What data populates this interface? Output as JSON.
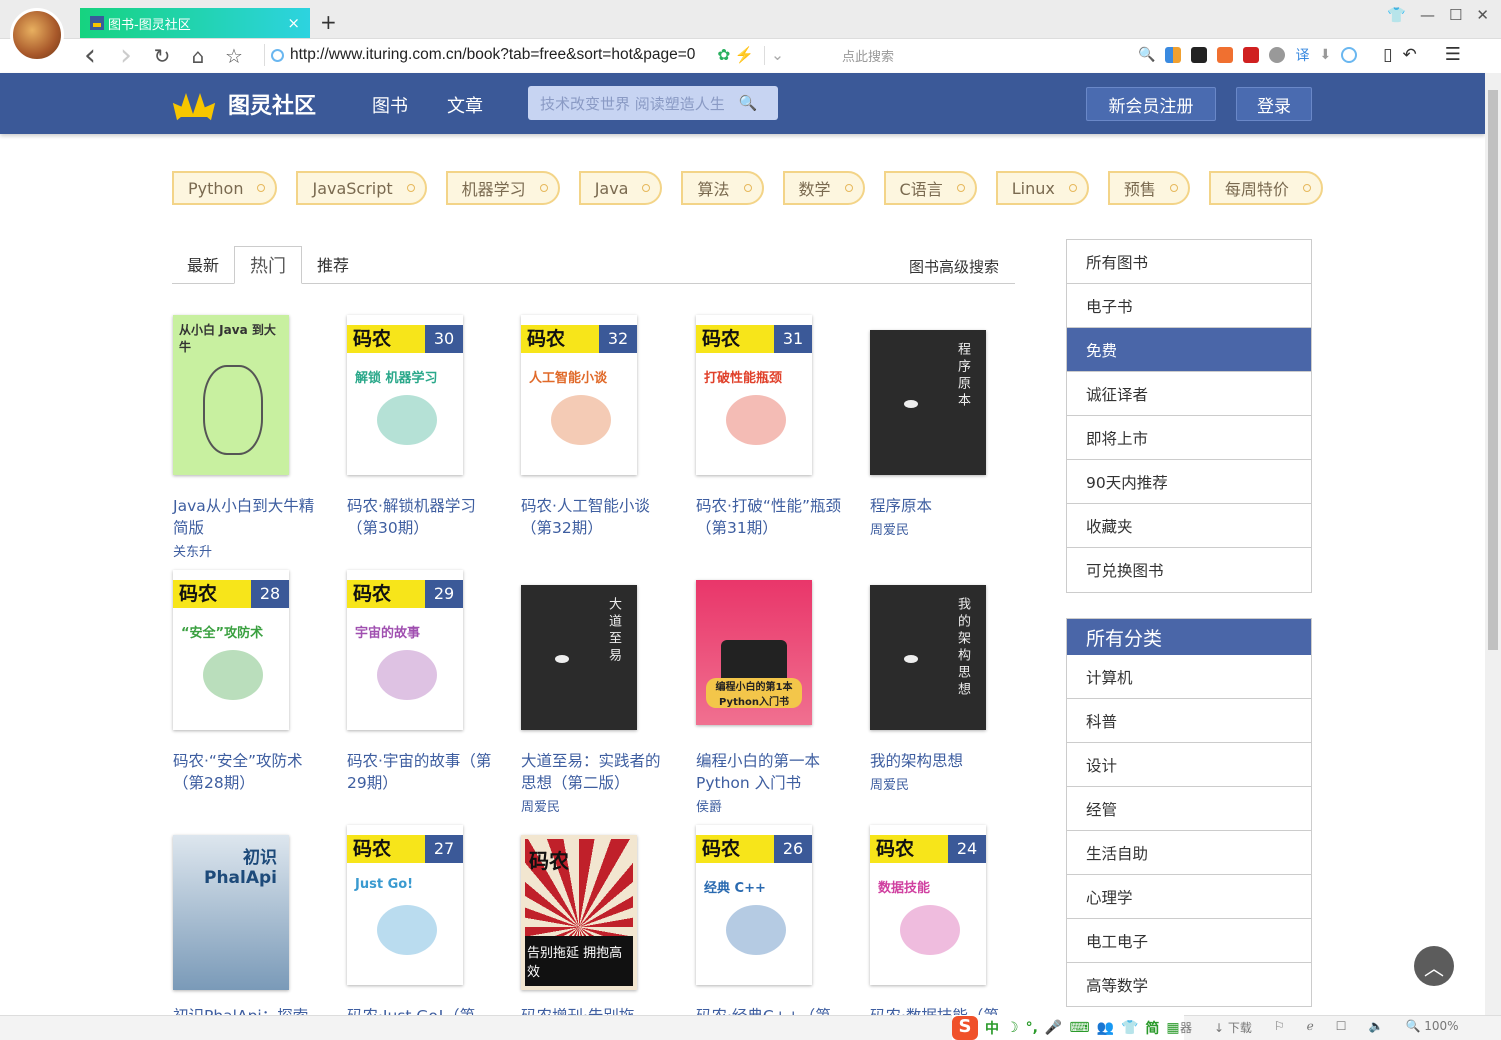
{
  "browser": {
    "tab_title": "图书-图灵社区",
    "tab_close": "×",
    "new_tab": "+",
    "url": "http://www.ituring.com.cn/book?tab=free&sort=hot&page=0",
    "search_placeholder": "点此搜索",
    "window_controls": [
      "shirt-icon",
      "minimize-icon",
      "maximize-icon",
      "close-icon"
    ],
    "nav": {
      "back": "‹",
      "forward": "›",
      "reload": "↻",
      "home": "⌂",
      "star": "☆"
    },
    "menu": "☰"
  },
  "site": {
    "logo": "图灵社区",
    "nav": [
      "图书",
      "文章"
    ],
    "search_placeholder": "技术改变世界 阅读塑造人生",
    "register": "新会员注册",
    "login": "登录",
    "brand_color": "#3b5998"
  },
  "tags": [
    "Python",
    "JavaScript",
    "机器学习",
    "Java",
    "算法",
    "数学",
    "C语言",
    "Linux",
    "预售",
    "每周特价"
  ],
  "sort_tabs": {
    "items": [
      "最新",
      "热门",
      "推荐"
    ],
    "active": "热门",
    "advanced": "图书高级搜索"
  },
  "books": [
    {
      "title": "Java从小白到大牛精简版",
      "author": "关东升",
      "cover": "green",
      "cover_text": "从小白 Java 到大牛"
    },
    {
      "title": "码农·解锁机器学习（第30期）",
      "author": "",
      "cover": "maneng",
      "issue": "30",
      "cover_text": "解锁 机器学习",
      "sub_color": "#2aa88a"
    },
    {
      "title": "码农·人工智能小谈（第32期）",
      "author": "",
      "cover": "maneng",
      "issue": "32",
      "cover_text": "人工智能小谈",
      "sub_color": "#e06a2a"
    },
    {
      "title": "码农·打破“性能”瓶颈（第31期）",
      "author": "",
      "cover": "maneng",
      "issue": "31",
      "cover_text": "打破性能瓶颈",
      "sub_color": "#e0402a"
    },
    {
      "title": "程序原本",
      "author": "周爱民",
      "cover": "dark",
      "cover_text": "程序原本"
    },
    {
      "title": "码农·“安全”攻防术（第28期）",
      "author": "",
      "cover": "maneng",
      "issue": "28",
      "cover_text": "“安全”攻防术",
      "sub_color": "#3aa040"
    },
    {
      "title": "码农·宇宙的故事（第29期）",
      "author": "",
      "cover": "maneng",
      "issue": "29",
      "cover_text": "宇宙的故事",
      "sub_color": "#a050b0"
    },
    {
      "title": "大道至易：实践者的思想（第二版）",
      "author": "周爱民",
      "cover": "dark",
      "cover_text": "大道至易"
    },
    {
      "title": "编程小白的第一本 Python 入门书",
      "author": "侯爵",
      "cover": "red",
      "cover_text": "编程小白的第1本 Python入门书"
    },
    {
      "title": "我的架构思想",
      "author": "周爱民",
      "cover": "dark",
      "cover_text": "我的架构思想"
    },
    {
      "title": "初识PhalApi：探索",
      "author": "",
      "cover": "blue",
      "cover_text": "初识 PhalApi"
    },
    {
      "title": "码农·Just Go!（第",
      "author": "",
      "cover": "maneng",
      "issue": "27",
      "cover_text": "Just Go!",
      "sub_color": "#3a9ad0"
    },
    {
      "title": "码农增刊·告别拖",
      "author": "",
      "cover": "poster",
      "cover_text": "告别拖延 拥抱高效"
    },
    {
      "title": "码农·经典C++（第",
      "author": "",
      "cover": "maneng",
      "issue": "26",
      "cover_text": "经典 C++",
      "sub_color": "#2a6ab0"
    },
    {
      "title": "码农·数据技能（第",
      "author": "",
      "cover": "maneng",
      "issue": "24",
      "cover_text": "数据技能",
      "sub_color": "#d040a0"
    }
  ],
  "maneng_label": "码农",
  "sidebar": {
    "filters": [
      "所有图书",
      "电子书",
      "免费",
      "诚征译者",
      "即将上市",
      "90天内推荐",
      "收藏夹",
      "可兑换图书"
    ],
    "active_filter": "免费",
    "category_title": "所有分类",
    "categories": [
      "计算机",
      "科普",
      "设计",
      "经管",
      "生活自助",
      "心理学",
      "电工电子",
      "高等数学"
    ]
  },
  "statusbar": {
    "ime": [
      "中",
      "☽",
      "°,",
      "🎤",
      "⌨",
      "👥",
      "👕",
      "简",
      "▦"
    ],
    "partial": "器",
    "download": "↓ 下载",
    "zoom": "100%"
  }
}
